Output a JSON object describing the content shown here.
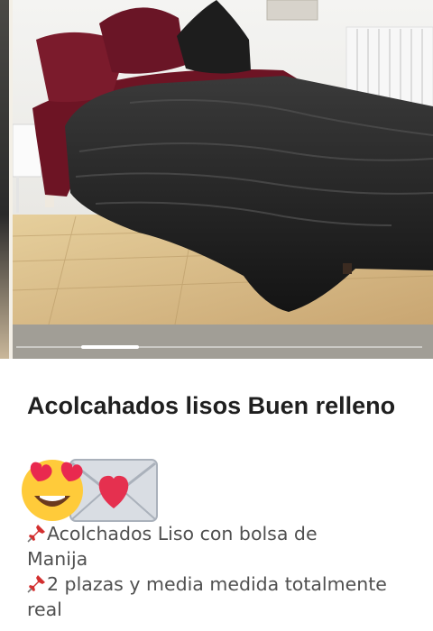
{
  "listing": {
    "title": "Acolcahados lisos Buen relleno",
    "description": {
      "line1": "Acolchados Liso con bolsa de",
      "line2": "Manija",
      "line3": "2 plazas y media medida totalmente",
      "line4": "real"
    }
  },
  "carousel": {
    "image": "black comforter on bed with burgundy sheets and pillows",
    "active_index": 1
  },
  "icons": {
    "emoji_1": "heart-eyes-emoji-icon",
    "emoji_2": "love-letter-emoji-icon",
    "bullet": "pushpin-icon"
  },
  "colors": {
    "title": "#1f1f1f",
    "description": "#505050",
    "pin": "#d32f2f"
  }
}
